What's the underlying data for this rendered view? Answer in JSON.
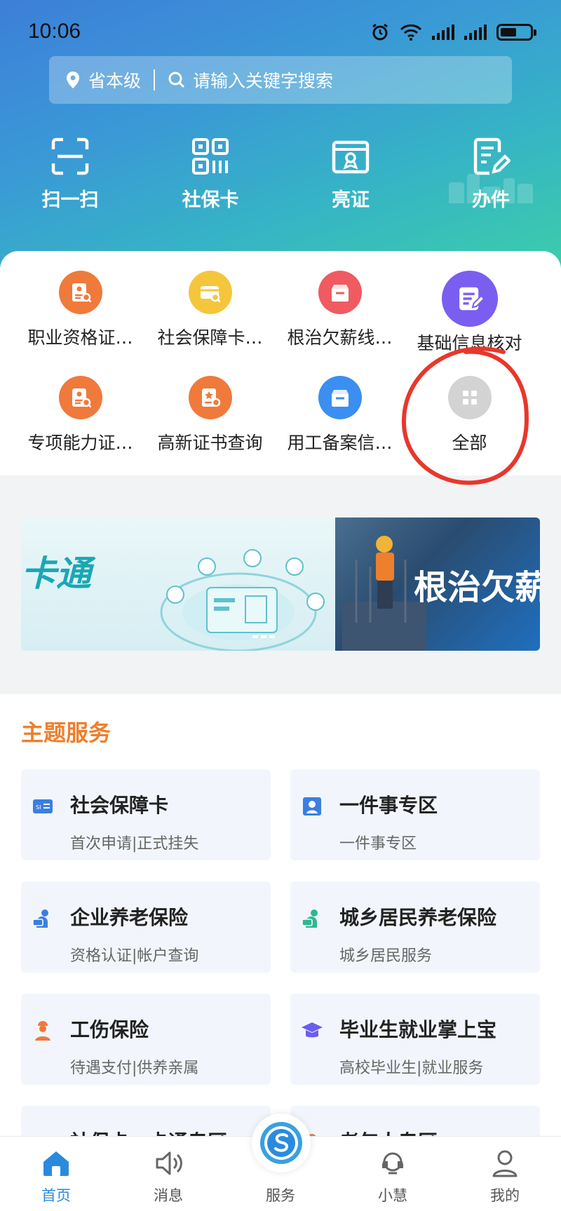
{
  "status_bar": {
    "time": "10:06"
  },
  "search": {
    "location": "省本级",
    "placeholder": "请输入关键字搜索"
  },
  "quick_actions": [
    {
      "label": "扫一扫",
      "icon": "scan-icon"
    },
    {
      "label": "社保卡",
      "icon": "qr-code-icon"
    },
    {
      "label": "亮证",
      "icon": "certificate-icon"
    },
    {
      "label": "办件",
      "icon": "form-edit-icon"
    }
  ],
  "services": [
    {
      "label": "职业资格证书查询",
      "display": "职业资格证…",
      "icon": "certificate-search-icon",
      "color": "#ef7a3b"
    },
    {
      "label": "社会保障卡应用",
      "display": "社会保障卡…",
      "icon": "card-search-icon",
      "color": "#f5c63c"
    },
    {
      "label": "根治欠薪线索反映",
      "display": "根治欠薪线…",
      "icon": "inbox-icon",
      "color": "#ef5b61"
    },
    {
      "label": "基础信息核对",
      "display": "基础信息核对",
      "icon": "edit-document-icon",
      "color": "#7a5ef0"
    },
    {
      "label": "专项能力证书查询",
      "display": "专项能力证…",
      "icon": "certificate-search-icon",
      "color": "#ef7a3b"
    },
    {
      "label": "高新证书查询",
      "display": "高新证书查询",
      "icon": "star-certificate-icon",
      "color": "#ef7a3b"
    },
    {
      "label": "用工备案信息查询",
      "display": "用工备案信…",
      "icon": "inbox-icon",
      "color": "#3b8ff0"
    },
    {
      "label": "全部",
      "display": "全部",
      "icon": "grid-icon",
      "color": "#d3d3d3"
    }
  ],
  "banner": {
    "left_text": "卡通",
    "right_text": "根治欠薪"
  },
  "theme": {
    "title": "主题服务",
    "cards": [
      {
        "title": "社会保障卡",
        "subtitle": "首次申请|正式挂失",
        "icon": "social-security-card-icon",
        "color": "#3b7fe0"
      },
      {
        "title": "一件事专区",
        "subtitle": "一件事专区",
        "icon": "person-badge-icon",
        "color": "#3b7fe0"
      },
      {
        "title": "企业养老保险",
        "subtitle": "资格认证|帐户查询",
        "icon": "elderly-person-icon",
        "color": "#3b7fe0"
      },
      {
        "title": "城乡居民养老保险",
        "subtitle": "城乡居民服务",
        "icon": "resident-person-icon",
        "color": "#2eb890"
      },
      {
        "title": "工伤保险",
        "subtitle": "待遇支付|供养亲属",
        "icon": "worker-icon",
        "color": "#ef7a3b"
      },
      {
        "title": "毕业生就业掌上宝",
        "subtitle": "高校毕业生|就业服务",
        "icon": "graduate-cap-icon",
        "color": "#6a5ef0"
      },
      {
        "title": "社保卡一卡通专区",
        "subtitle": "",
        "icon": "card-icon",
        "color": "#3b7fe0"
      },
      {
        "title": "老年人专区",
        "subtitle": "",
        "icon": "elder-icon",
        "color": "#ef7a3b"
      }
    ]
  },
  "tabbar": {
    "items": [
      {
        "label": "首页",
        "icon": "home-icon"
      },
      {
        "label": "消息",
        "icon": "speaker-icon"
      },
      {
        "label": "服务",
        "icon": "service-logo-icon"
      },
      {
        "label": "小慧",
        "icon": "headset-icon"
      },
      {
        "label": "我的",
        "icon": "user-icon"
      }
    ],
    "active_color": "#2a8bde"
  }
}
